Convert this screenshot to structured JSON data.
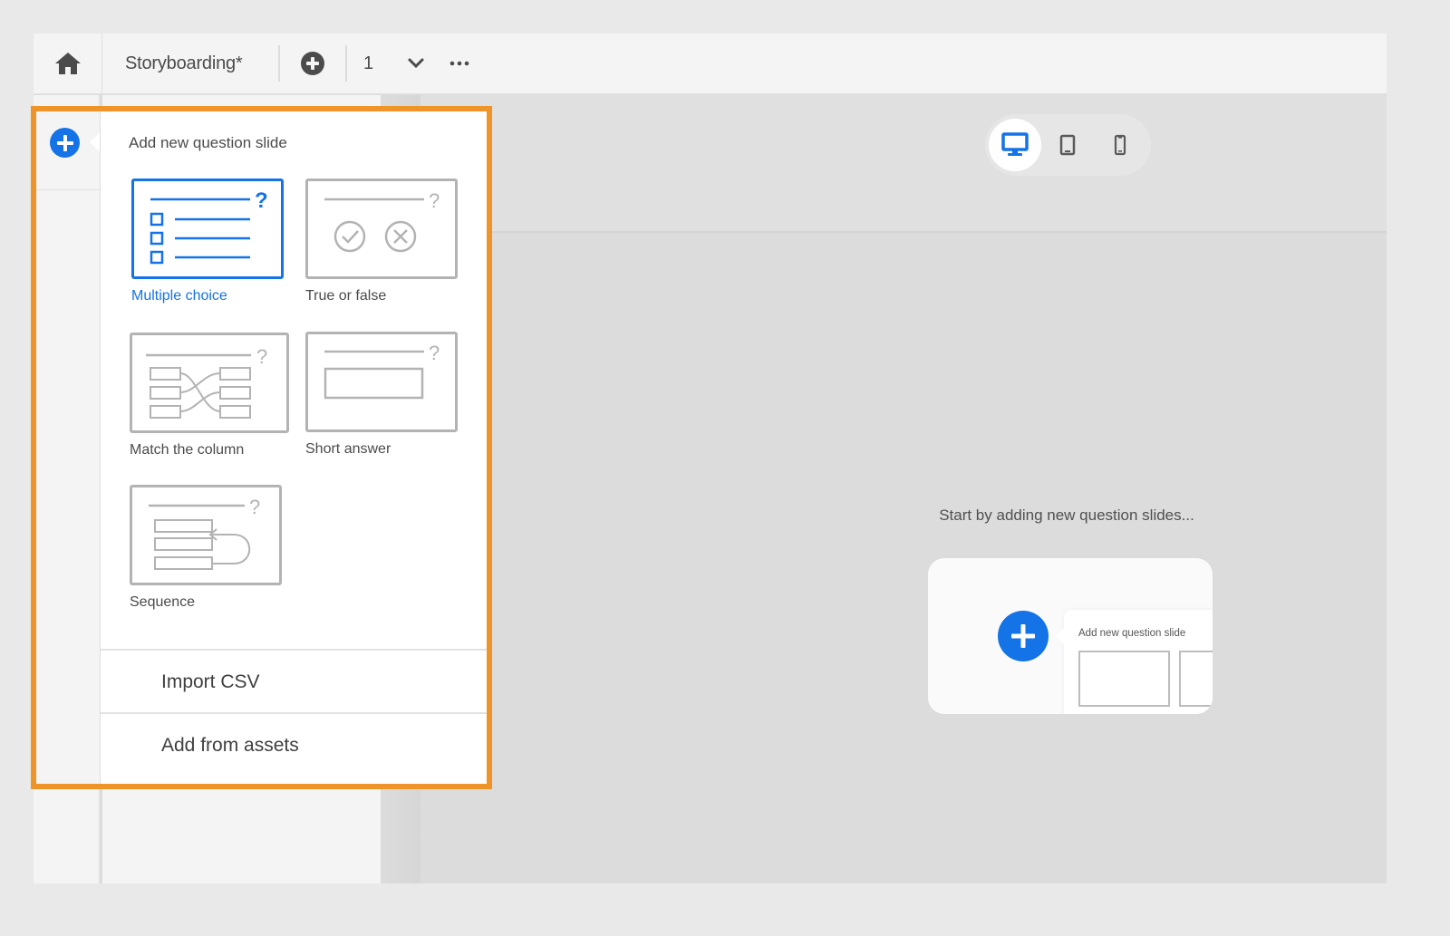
{
  "toolbar": {
    "home_icon": "home-icon",
    "title": "Storyboarding*",
    "add_icon": "plus-circle-icon",
    "page_number": "1",
    "chevron_icon": "chevron-down-icon",
    "more_icon": "more-horizontal-icon"
  },
  "device_switcher": {
    "devices": [
      {
        "name": "desktop",
        "icon": "desktop-icon",
        "active": true
      },
      {
        "name": "tablet",
        "icon": "tablet-icon",
        "active": false
      },
      {
        "name": "mobile",
        "icon": "mobile-icon",
        "active": false
      }
    ],
    "active_color": "#1473e6"
  },
  "add_question_panel": {
    "trigger_icon": "plus-circle-icon",
    "title": "Add new question slide",
    "question_types": [
      {
        "label": "Multiple choice",
        "icon": "multiple-choice-icon",
        "selected": true
      },
      {
        "label": "True or false",
        "icon": "true-false-icon",
        "selected": false
      },
      {
        "label": "Match the column",
        "icon": "match-column-icon",
        "selected": false
      },
      {
        "label": "Short answer",
        "icon": "short-answer-icon",
        "selected": false
      },
      {
        "label": "Sequence",
        "icon": "sequence-icon",
        "selected": false
      }
    ],
    "actions": [
      {
        "label": "Import CSV"
      },
      {
        "label": "Add from assets"
      }
    ],
    "highlight_color": "#ef9428",
    "accent_color": "#1473e6"
  },
  "empty_state": {
    "message": "Start by adding new question slides...",
    "preview": {
      "icon": "plus-circle-icon",
      "title": "Add new question slide"
    }
  }
}
